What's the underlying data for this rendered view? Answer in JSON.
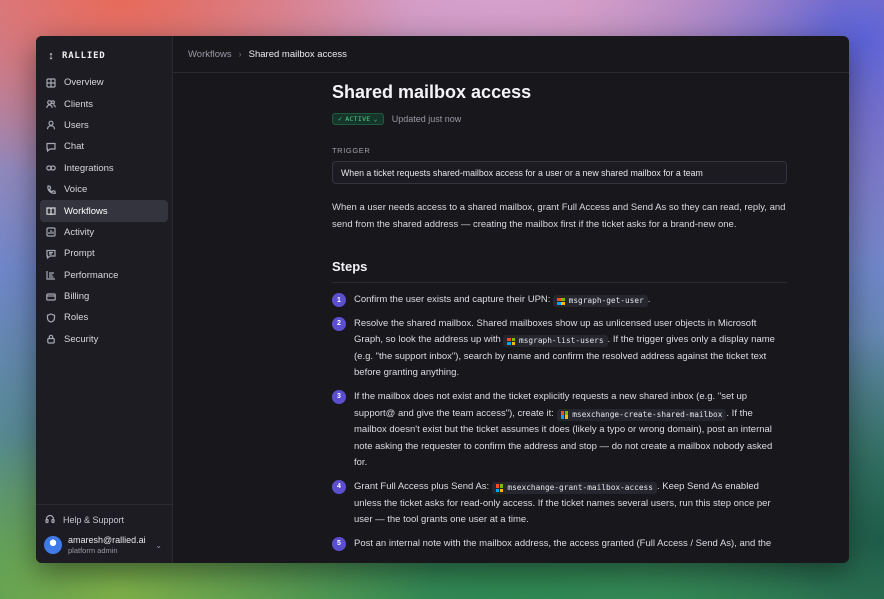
{
  "brand": {
    "name": "RALLIED"
  },
  "sidebar": {
    "items": [
      {
        "label": "Overview",
        "icon": "grid-icon"
      },
      {
        "label": "Clients",
        "icon": "people-icon"
      },
      {
        "label": "Users",
        "icon": "user-icon"
      },
      {
        "label": "Chat",
        "icon": "chat-icon"
      },
      {
        "label": "Integrations",
        "icon": "link-icon"
      },
      {
        "label": "Voice",
        "icon": "phone-icon"
      },
      {
        "label": "Workflows",
        "icon": "book-icon",
        "active": true
      },
      {
        "label": "Activity",
        "icon": "activity-icon"
      },
      {
        "label": "Prompt",
        "icon": "message-icon"
      },
      {
        "label": "Performance",
        "icon": "bars-icon"
      },
      {
        "label": "Billing",
        "icon": "card-icon"
      },
      {
        "label": "Roles",
        "icon": "shield-icon"
      },
      {
        "label": "Security",
        "icon": "lock-icon"
      }
    ],
    "help": "Help & Support",
    "user": {
      "email": "amaresh@rallied.ai",
      "role": "platform admin"
    }
  },
  "breadcrumb": {
    "parent": "Workflows",
    "current": "Shared mailbox access"
  },
  "page": {
    "title": "Shared mailbox access",
    "status": "ACTIVE",
    "updated": "Updated just now",
    "trigger_label": "TRIGGER",
    "trigger": "When a ticket requests shared-mailbox access for a user or a new shared mailbox for a team",
    "description": "When a user needs access to a shared mailbox, grant Full Access and Send As so they can read, reply, and send from the shared address — creating the mailbox first if the ticket asks for a brand-new one.",
    "steps_title": "Steps"
  },
  "steps": [
    {
      "n": "1",
      "before": "Confirm the user exists and capture their UPN: ",
      "tool": "msgraph-get-user",
      "after": "."
    },
    {
      "n": "2",
      "before": "Resolve the shared mailbox. Shared mailboxes show up as unlicensed user objects in Microsoft Graph, so look the address up with ",
      "tool": "msgraph-list-users",
      "after": ". If the trigger gives only a display name (e.g. \"the support inbox\"), search by name and confirm the resolved address against the ticket text before granting anything."
    },
    {
      "n": "3",
      "before": "If the mailbox does not exist and the ticket explicitly requests a new shared inbox (e.g. \"set up support@ and give the team access\"), create it: ",
      "tool": "msexchange-create-shared-mailbox",
      "after": ". If the mailbox doesn't exist but the ticket assumes it does (likely a typo or wrong domain), post an internal note asking the requester to confirm the address and stop — do not create a mailbox nobody asked for."
    },
    {
      "n": "4",
      "before": "Grant Full Access plus Send As: ",
      "tool": "msexchange-grant-mailbox-access",
      "after": ". Keep Send As enabled unless the ticket asks for read-only access. If the ticket names several users, run this step once per user — the tool grants one user at a time."
    },
    {
      "n": "5",
      "before": "Post an internal note with the mailbox address, the access granted (Full Access / Send As), and the",
      "tool": "",
      "after": ""
    }
  ]
}
